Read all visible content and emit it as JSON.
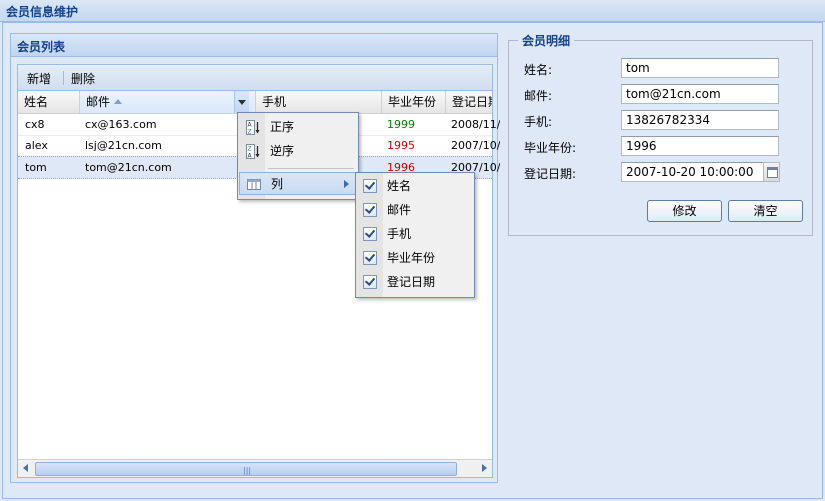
{
  "window": {
    "title": "会员信息维护"
  },
  "list_panel": {
    "title": "会员列表",
    "toolbar": {
      "add_label": "新增",
      "delete_label": "删除"
    },
    "columns": [
      "姓名",
      "邮件",
      "手机",
      "毕业年份",
      "登记日期"
    ],
    "rows": [
      {
        "name": "cx8",
        "email": "cx@163.com",
        "year": "1999",
        "year_color": "#008000",
        "date": "2008/11/"
      },
      {
        "name": "alex",
        "email": "lsj@21cn.com",
        "year": "1995",
        "year_color": "#cc0000",
        "date": "2007/10/"
      },
      {
        "name": "tom",
        "email": "tom@21cn.com",
        "year": "1996",
        "year_color": "#cc0000",
        "date": "2007/10/"
      }
    ],
    "selected_row": 2,
    "scrollbar_grip": "|||"
  },
  "header_menu": {
    "sort_asc": "正序",
    "sort_desc": "逆序",
    "columns_label": "列",
    "column_items": [
      {
        "label": "姓名",
        "checked": true
      },
      {
        "label": "邮件",
        "checked": true
      },
      {
        "label": "手机",
        "checked": true
      },
      {
        "label": "毕业年份",
        "checked": true
      },
      {
        "label": "登记日期",
        "checked": true
      }
    ]
  },
  "detail": {
    "legend": "会员明细",
    "fields": {
      "name_label": "姓名:",
      "name_value": "tom",
      "email_label": "邮件:",
      "email_value": "tom@21cn.com",
      "phone_label": "手机:",
      "phone_value": "13826782334",
      "year_label": "毕业年份:",
      "year_value": "1996",
      "date_label": "登记日期:",
      "date_value": "2007-10-20 10:00:00"
    },
    "edit_button": "修改",
    "clear_button": "清空"
  },
  "colors": {
    "accent": "#15428b",
    "border": "#99bbe8",
    "panel_bg": "#dfe8f6"
  }
}
